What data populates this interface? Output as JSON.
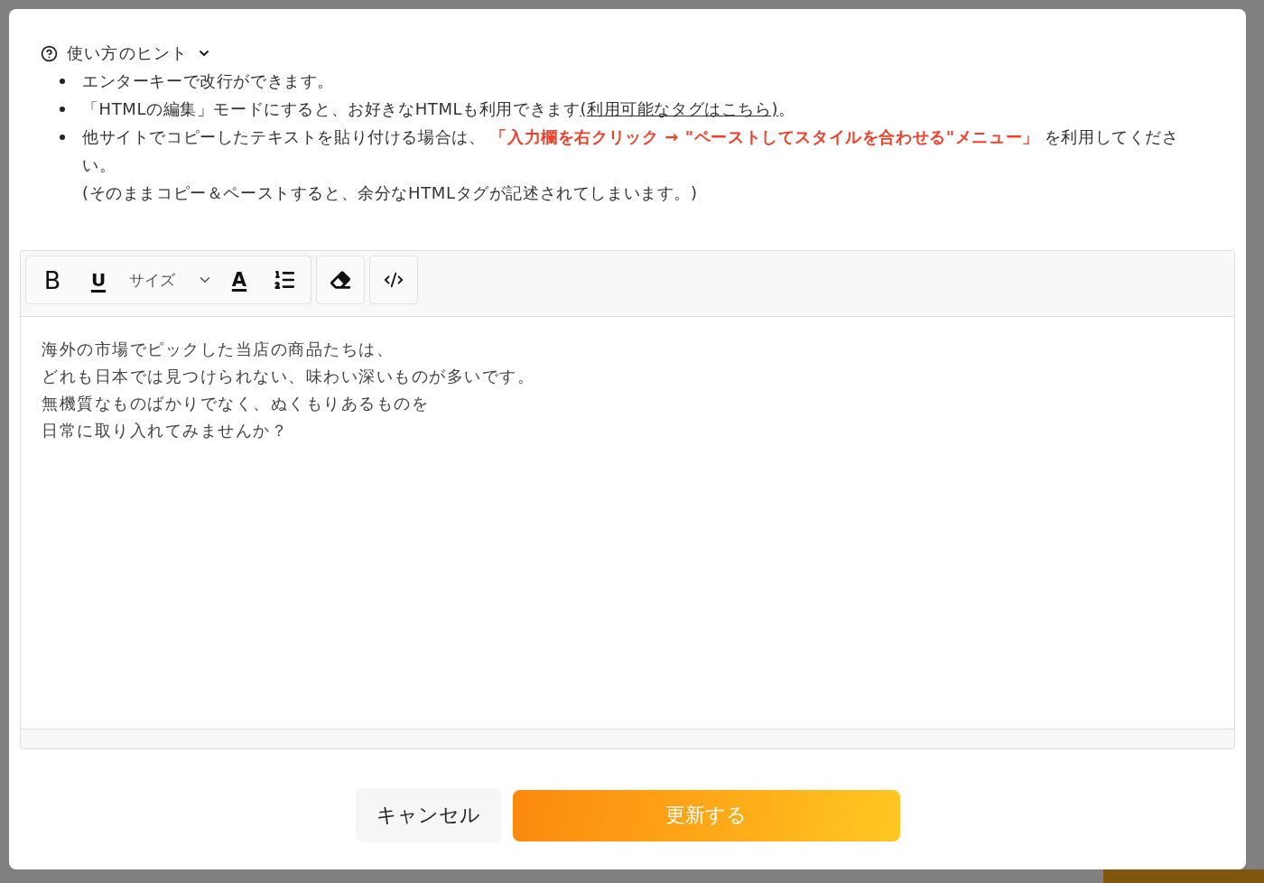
{
  "hint": {
    "title": "使い方のヒント",
    "expanded": true,
    "items": [
      {
        "text": "エンターキーで改行ができます。"
      },
      {
        "text": "「HTMLの編集」モードにすると、お好きなHTMLも利用できます",
        "link": "(利用可能なタグはこちら)",
        "link_suffix": "。"
      },
      {
        "text": "他サイトでコピーしたテキストを貼り付ける場合は、**「入力欄を右クリック → \"ペーストしてスタイルを合わせる\"メニュー」**を利用してください。",
        "note": "(そのままコピー＆ペーストすると、余分なHTMLタグが記述されてしまいます。)"
      }
    ]
  },
  "editor": {
    "toolbar": [
      {
        "tools": [
          {
            "kind": "bold",
            "label": "B"
          },
          {
            "kind": "underline",
            "label": "U"
          },
          {
            "kind": "select",
            "label": "サイズ"
          },
          {
            "kind": "color",
            "label": "A"
          },
          {
            "kind": "ordered-list"
          }
        ]
      },
      {
        "tools": [
          {
            "kind": "eraser"
          }
        ]
      },
      {
        "tools": [
          {
            "kind": "code"
          }
        ]
      }
    ],
    "lines": [
      "海外の市場でピックした当店の商品たちは、",
      "どれも日本では見つけられない、味わい深いものが多いです。",
      "無機質なものばかりでなく、ぬくもりあるものを",
      "日常に取り入れてみませんか？"
    ]
  },
  "buttons": [
    {
      "kind": "secondary",
      "label": "キャンセル"
    },
    {
      "kind": "primary",
      "label": "更新する"
    }
  ]
}
